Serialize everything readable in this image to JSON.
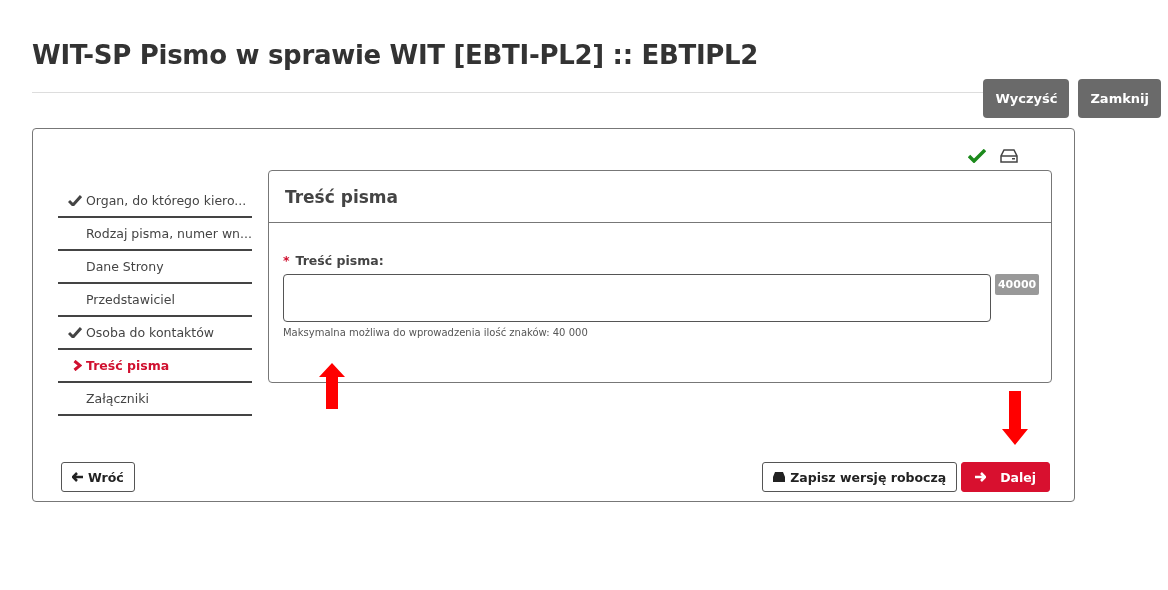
{
  "title": "WIT-SP Pismo w sprawie WIT [EBTI-PL2] :: EBTIPL2",
  "header_buttons": [
    "Wyczyść",
    "Zamknij"
  ],
  "status": {
    "valid": true
  },
  "steps": [
    {
      "label": "Organ, do którego kiero...",
      "completed": true,
      "selected": false
    },
    {
      "label": "Rodzaj pisma, numer wn...",
      "completed": false,
      "selected": false
    },
    {
      "label": "Dane Strony",
      "completed": false,
      "selected": false
    },
    {
      "label": "Przedstawiciel",
      "completed": false,
      "selected": false
    },
    {
      "label": "Osoba do kontaktów",
      "completed": true,
      "selected": false
    },
    {
      "label": "Treść pisma",
      "completed": false,
      "selected": true
    },
    {
      "label": "Załączniki",
      "completed": false,
      "selected": false
    }
  ],
  "panel": {
    "title": "Treść pisma",
    "field_label": "Treść pisma:",
    "required": true,
    "required_mark": "*",
    "counter": "40000",
    "hint": "Maksymalna możliwa do wprowadzenia ilość znaków: 40 000"
  },
  "footer": {
    "back": "Wróć",
    "save": "Zapisz wersję roboczą",
    "next": "Dalej"
  }
}
